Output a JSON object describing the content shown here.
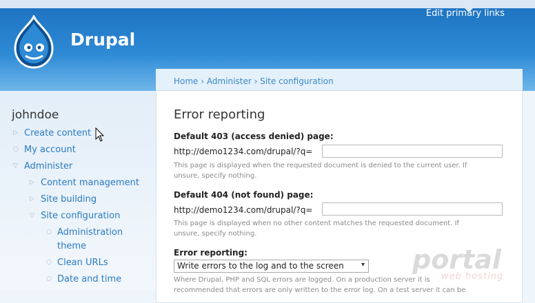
{
  "header": {
    "site_name": "Drupal",
    "primary_links_label": "Edit primary links"
  },
  "sidebar": {
    "username": "johndoe",
    "items": [
      {
        "label": "Create content",
        "level": 0,
        "bullet": "▷"
      },
      {
        "label": "My account",
        "level": 0,
        "bullet": "○"
      },
      {
        "label": "Administer",
        "level": 0,
        "bullet": "▽"
      },
      {
        "label": "Content management",
        "level": 1,
        "bullet": "▷"
      },
      {
        "label": "Site building",
        "level": 1,
        "bullet": "▷"
      },
      {
        "label": "Site configuration",
        "level": 1,
        "bullet": "▽"
      },
      {
        "label": "Administration",
        "level": 2,
        "bullet": "○"
      },
      {
        "label": "theme",
        "level": 2,
        "bullet": ""
      },
      {
        "label": "Clean URLs",
        "level": 2,
        "bullet": "○"
      },
      {
        "label": "Date and time",
        "level": 2,
        "bullet": "○"
      }
    ]
  },
  "breadcrumb": {
    "home": "Home",
    "administer": "Administer",
    "site_config": "Site configuration",
    "separator": "›"
  },
  "main": {
    "title": "Error reporting",
    "field403": {
      "label": "Default 403 (access denied) page:",
      "prefix": "http://demo1234.com/drupal/?q=",
      "value": "",
      "desc_line1": "This page is displayed when the requested document is denied to the current user. If",
      "desc_line2": "unsure, specify nothing."
    },
    "field404": {
      "label": "Default 404 (not found) page:",
      "prefix": "http://demo1234.com/drupal/?q=",
      "value": "",
      "desc_line1": "This page is displayed when no other content matches the requested document. If",
      "desc_line2": "unsure, specify nothing."
    },
    "error_reporting": {
      "label": "Error reporting:",
      "selected": "Write errors to the log and to the screen",
      "desc_line1": "Where Drupal, PHP and SQL errors are logged. On a production server it is",
      "desc_line2": "recommended that errors are only written to the error log. On a test server it can be"
    }
  },
  "watermark": {
    "brand": "portal",
    "sub": "web hosting"
  },
  "colors": {
    "header_blue": "#2d8ad5",
    "link_blue": "#2a7bc0"
  }
}
